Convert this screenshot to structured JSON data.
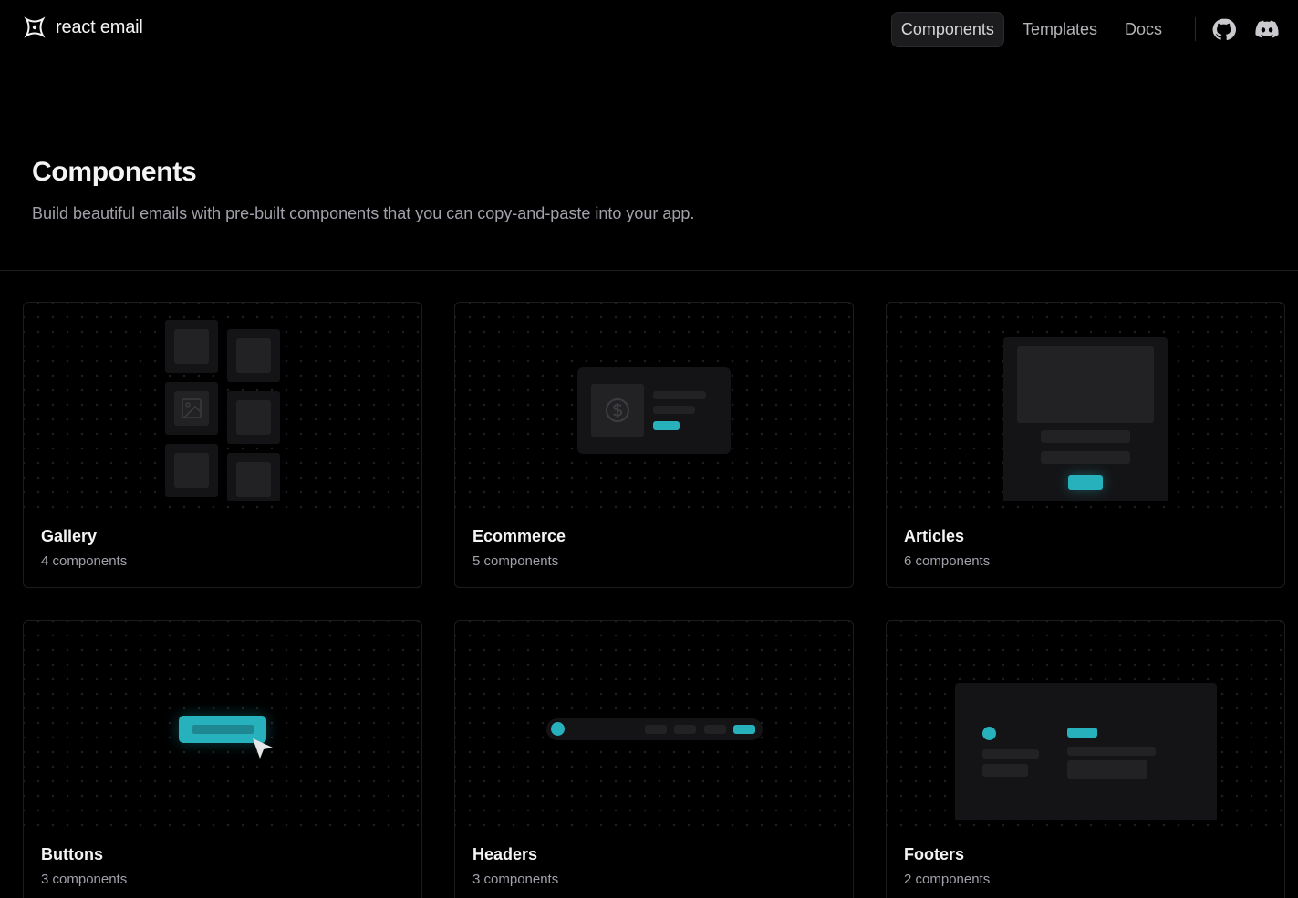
{
  "brand": {
    "name": "react email"
  },
  "nav": {
    "items": [
      {
        "label": "Components",
        "active": true
      },
      {
        "label": "Templates",
        "active": false
      },
      {
        "label": "Docs",
        "active": false
      }
    ],
    "icons": [
      "github-icon",
      "discord-icon"
    ]
  },
  "hero": {
    "title": "Components",
    "subtitle": "Build beautiful emails with pre-built components that you can copy-and-paste into your app."
  },
  "cards": [
    {
      "title": "Gallery",
      "count": "4 components"
    },
    {
      "title": "Ecommerce",
      "count": "5 components"
    },
    {
      "title": "Articles",
      "count": "6 components"
    },
    {
      "title": "Buttons",
      "count": "3 components"
    },
    {
      "title": "Headers",
      "count": "3 components"
    },
    {
      "title": "Footers",
      "count": "2 components"
    }
  ],
  "colors": {
    "accent": "#26b1bd",
    "background": "#000000"
  }
}
